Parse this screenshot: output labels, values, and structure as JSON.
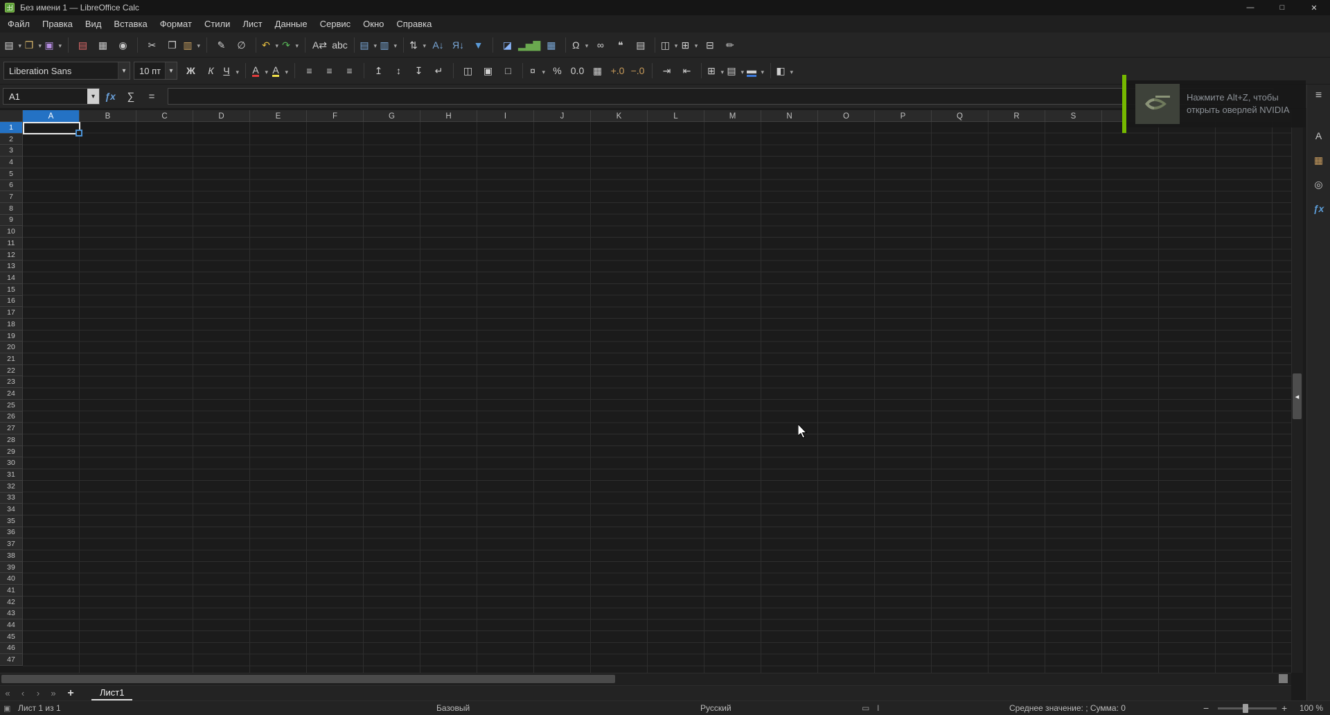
{
  "window": {
    "title": "Без имени 1 — LibreOffice Calc",
    "controls": [
      {
        "name": "minimize-button",
        "glyph": "—"
      },
      {
        "name": "maximize-button",
        "glyph": "□"
      },
      {
        "name": "close-button",
        "glyph": "✕"
      }
    ]
  },
  "menu_items": [
    "Файл",
    "Правка",
    "Вид",
    "Вставка",
    "Формат",
    "Стили",
    "Лист",
    "Данные",
    "Сервис",
    "Окно",
    "Справка"
  ],
  "standard_toolbar": [
    {
      "name": "new-document-button",
      "glyph": "▤",
      "dd": true,
      "color": "#d8d8d8"
    },
    {
      "name": "open-button",
      "glyph": "❒",
      "dd": true,
      "color": "#d8b66a"
    },
    {
      "name": "save-button",
      "glyph": "▣",
      "dd": true,
      "color": "#b48ce0"
    },
    {
      "sep": true
    },
    {
      "name": "export-pdf-button",
      "glyph": "▤",
      "color": "#e06c6c"
    },
    {
      "name": "print-button",
      "glyph": "▦",
      "color": "#c8c8c8"
    },
    {
      "name": "print-preview-button",
      "glyph": "◉",
      "color": "#c8c8c8"
    },
    {
      "sep": true
    },
    {
      "name": "cut-button",
      "glyph": "✂",
      "color": "#d0d0d0"
    },
    {
      "name": "copy-button",
      "glyph": "❐",
      "color": "#d0d0d0"
    },
    {
      "name": "paste-button",
      "glyph": "▥",
      "dd": true,
      "color": "#c8a060"
    },
    {
      "sep": true
    },
    {
      "name": "clone-formatting-button",
      "glyph": "✎",
      "color": "#d0d0d0"
    },
    {
      "name": "clear-formatting-button",
      "glyph": "∅",
      "color": "#d0d0d0"
    },
    {
      "sep": true
    },
    {
      "name": "undo-button",
      "glyph": "↶",
      "dd": true,
      "color": "#e8c040"
    },
    {
      "name": "redo-button",
      "glyph": "↷",
      "dd": true,
      "color": "#58b858"
    },
    {
      "sep": true
    },
    {
      "name": "find-replace-button",
      "glyph": "A⇄",
      "color": "#d0d0d0"
    },
    {
      "name": "spelling-button",
      "glyph": "abc",
      "color": "#d0d0d0"
    },
    {
      "sep": true
    },
    {
      "name": "insert-row-button",
      "glyph": "▤",
      "dd": true,
      "color": "#7aa8d8"
    },
    {
      "name": "insert-column-button",
      "glyph": "▥",
      "dd": true,
      "color": "#7aa8d8"
    },
    {
      "sep": true
    },
    {
      "name": "sort-button",
      "glyph": "⇅",
      "dd": true,
      "color": "#d0d0d0"
    },
    {
      "name": "sort-ascending-button",
      "glyph": "А↓",
      "color": "#7aa8d8"
    },
    {
      "name": "sort-descending-button",
      "glyph": "Я↓",
      "color": "#7aa8d8"
    },
    {
      "name": "autofilter-button",
      "glyph": "▼",
      "color": "#5a9ad8"
    },
    {
      "sep": true
    },
    {
      "name": "insert-image-button",
      "glyph": "◪",
      "color": "#8ab4f8"
    },
    {
      "name": "insert-chart-button",
      "glyph": "▂▅▇",
      "color": "#6aa84f"
    },
    {
      "name": "insert-pivot-table-button",
      "glyph": "▦",
      "color": "#7aa8d8"
    },
    {
      "sep": true
    },
    {
      "name": "special-character-button",
      "glyph": "Ω",
      "dd": true,
      "color": "#d0d0d0"
    },
    {
      "name": "hyperlink-button",
      "glyph": "∞",
      "color": "#d0d0d0"
    },
    {
      "name": "insert-comment-button",
      "glyph": "❝",
      "color": "#d0d0d0"
    },
    {
      "name": "headers-footers-button",
      "glyph": "▤",
      "color": "#d0d0d0"
    },
    {
      "sep": true
    },
    {
      "name": "freeze-rows-columns-button",
      "glyph": "◫",
      "dd": true,
      "color": "#d0d0d0"
    },
    {
      "name": "freeze-cells-button",
      "glyph": "⊞",
      "dd": true,
      "color": "#d0d0d0"
    },
    {
      "name": "split-window-button",
      "glyph": "⊟",
      "color": "#d0d0d0"
    },
    {
      "name": "show-draw-functions-button",
      "glyph": "✏",
      "color": "#d0d0d0"
    }
  ],
  "formatting_toolbar": {
    "font_name": "Liberation Sans",
    "font_size": "10 пт",
    "buttons": [
      {
        "name": "bold-button",
        "glyph": "Ж",
        "cls": "b"
      },
      {
        "name": "italic-button",
        "glyph": "К",
        "cls": "i"
      },
      {
        "name": "underline-button",
        "glyph": "Ч",
        "cls": "u",
        "dd": true
      },
      {
        "sep": true
      },
      {
        "name": "font-color-button",
        "glyph": "А",
        "bar": "#e03c3c",
        "dd": true
      },
      {
        "name": "highlight-color-button",
        "glyph": "А",
        "bar": "#f0e04a",
        "dd": true
      },
      {
        "sep": true
      },
      {
        "name": "align-left-button",
        "glyph": "≡"
      },
      {
        "name": "align-center-button",
        "glyph": "≡"
      },
      {
        "name": "align-right-button",
        "glyph": "≡"
      },
      {
        "sep": true
      },
      {
        "name": "align-top-button",
        "glyph": "↥"
      },
      {
        "name": "center-vertically-button",
        "glyph": "↕"
      },
      {
        "name": "align-bottom-button",
        "glyph": "↧"
      },
      {
        "name": "wrap-text-button",
        "glyph": "↵"
      },
      {
        "sep": true
      },
      {
        "name": "merge-center-cells-button",
        "glyph": "◫"
      },
      {
        "name": "merge-cells-button",
        "glyph": "▣"
      },
      {
        "name": "unmerge-cells-button",
        "glyph": "□"
      },
      {
        "sep": true
      },
      {
        "name": "format-currency-button",
        "glyph": "¤",
        "dd": true
      },
      {
        "name": "format-percent-button",
        "glyph": "%"
      },
      {
        "name": "format-number-button",
        "glyph": "0.0"
      },
      {
        "name": "format-date-button",
        "glyph": "▦"
      },
      {
        "name": "add-decimal-button",
        "glyph": "+.0",
        "color": "#c89b5a"
      },
      {
        "name": "delete-decimal-button",
        "glyph": "−.0",
        "color": "#c89b5a"
      },
      {
        "sep": true
      },
      {
        "name": "increase-indent-button",
        "glyph": "⇥"
      },
      {
        "name": "decrease-indent-button",
        "glyph": "⇤"
      },
      {
        "sep": true
      },
      {
        "name": "borders-button",
        "glyph": "⊞",
        "dd": true
      },
      {
        "name": "border-style-button",
        "glyph": "▤",
        "dd": true
      },
      {
        "name": "border-color-button",
        "glyph": "▬",
        "bar": "#3c78d8",
        "dd": true
      },
      {
        "sep": true
      },
      {
        "name": "conditional-formatting-button",
        "glyph": "◧",
        "dd": true
      }
    ]
  },
  "formula_bar": {
    "cell_ref": "A1",
    "dropdown_glyph": "▾",
    "fx_glyph": "ƒx",
    "sigma_glyph": "∑",
    "equals_glyph": "="
  },
  "grid": {
    "columns": [
      "A",
      "B",
      "C",
      "D",
      "E",
      "F",
      "G",
      "H",
      "I",
      "J",
      "K",
      "L",
      "M",
      "N",
      "O",
      "P",
      "Q",
      "R",
      "S"
    ],
    "row_count": 47,
    "selected_column": "A",
    "selected_row": "1",
    "collapse_glyph": "◂"
  },
  "nvidia": {
    "line1": "Нажмите Alt+Z, чтобы",
    "line2": "открыть оверлей NVIDIA"
  },
  "sidebar_icons": [
    {
      "name": "sidebar-settings-icon",
      "glyph": "≡"
    },
    {
      "name": "styles-icon",
      "glyph": "A"
    },
    {
      "name": "gallery-icon",
      "glyph": "▦",
      "color": "#c79b5e"
    },
    {
      "name": "navigator-icon",
      "glyph": "◎"
    },
    {
      "name": "functions-icon",
      "glyph": "ƒx",
      "color": "#5b9bd5",
      "cls": "i"
    }
  ],
  "sheet_tabs": {
    "nav": [
      {
        "name": "first-sheet-button",
        "glyph": "«"
      },
      {
        "name": "previous-sheet-button",
        "glyph": "‹"
      },
      {
        "name": "next-sheet-button",
        "glyph": "›"
      },
      {
        "name": "last-sheet-button",
        "glyph": "»"
      }
    ],
    "add_label": "+",
    "tabs": [
      {
        "name": "sheet-tab-list1",
        "label": "Лист1",
        "active": true
      }
    ]
  },
  "status_bar": {
    "modified_glyph": "▣",
    "sheet_info": "Лист 1 из 1",
    "page_style": "Базовый",
    "language": "Русский",
    "selection_glyph": "▭",
    "caret_glyph": "I",
    "stats": "Среднее значение: ; Сумма: 0",
    "zoom_out": "−",
    "zoom_in": "+",
    "zoom_level": "100 %"
  }
}
